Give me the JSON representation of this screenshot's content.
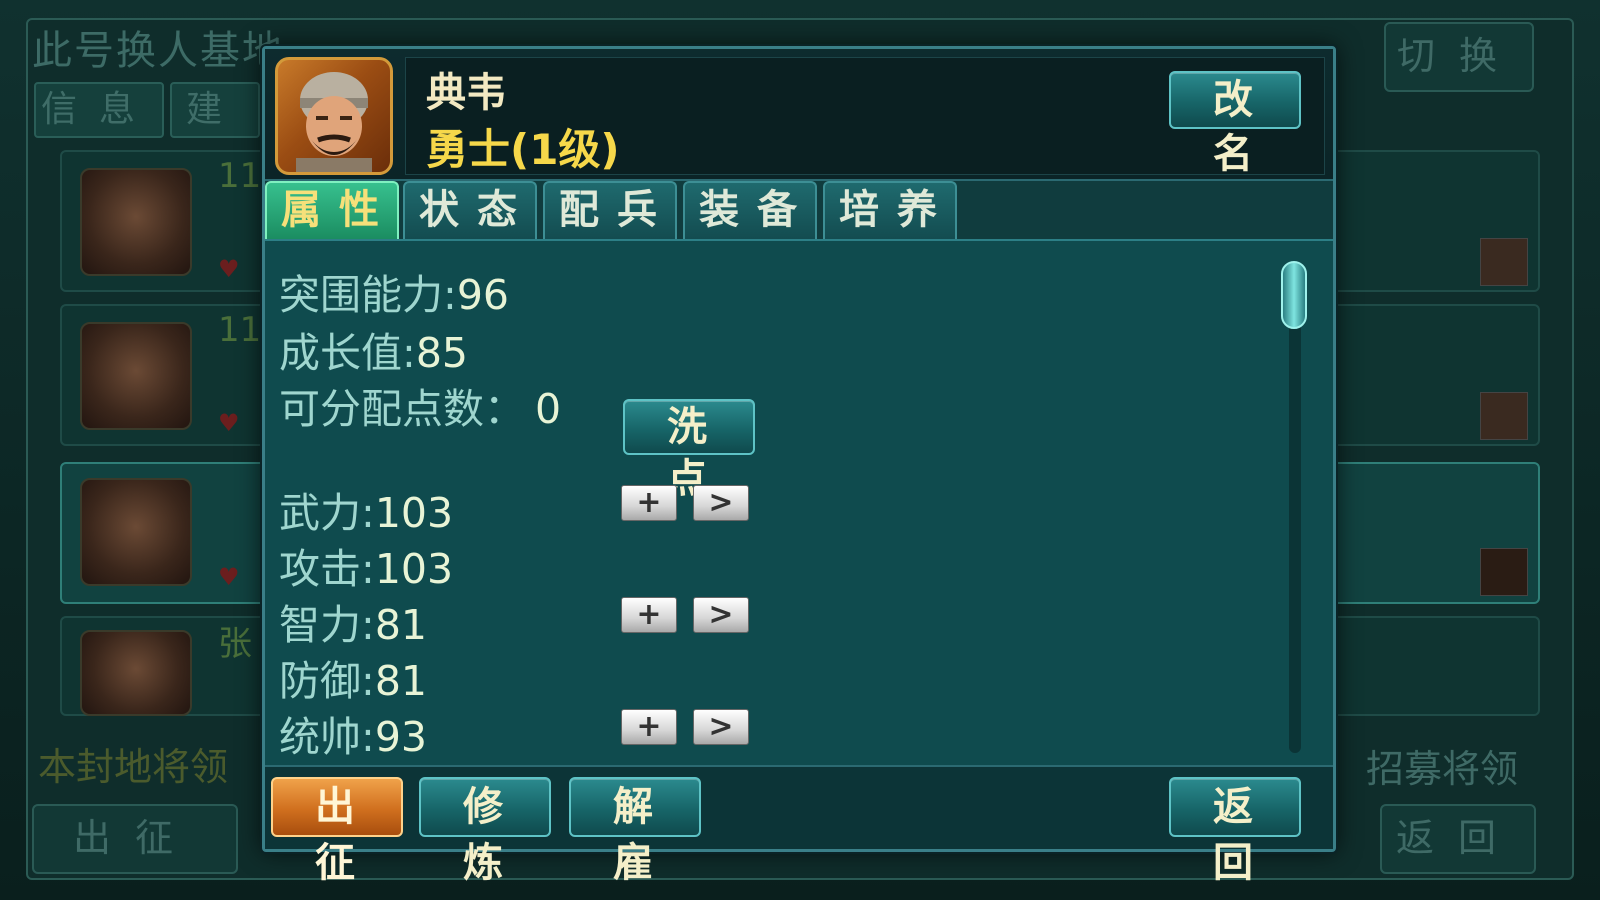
{
  "background": {
    "title": "此号换人基地",
    "tabs": [
      "信息",
      "建"
    ],
    "switch_button": "切换",
    "recruit_label": "招募将领",
    "fief_label": "本封地将领",
    "levels": [
      "11",
      "11"
    ],
    "bottom_left_button": "出征",
    "bottom_right_button": "返回",
    "list_name_fragment": "张"
  },
  "hero": {
    "name": "典韦",
    "rank": "勇士(1级)"
  },
  "rename_button": "改名",
  "tabs": [
    {
      "label": "属性",
      "active": true
    },
    {
      "label": "状态",
      "active": false
    },
    {
      "label": "配兵",
      "active": false
    },
    {
      "label": "装备",
      "active": false
    },
    {
      "label": "培养",
      "active": false
    }
  ],
  "stats": {
    "breakout": {
      "label": "突围能力:",
      "value": "96"
    },
    "growth": {
      "label": "成长值:",
      "value": "85"
    },
    "points": {
      "label": "可分配点数：",
      "value": "0"
    },
    "force": {
      "label": "武力:",
      "value": "103"
    },
    "attack": {
      "label": "攻击:",
      "value": "103"
    },
    "intellect": {
      "label": "智力:",
      "value": "81"
    },
    "defense": {
      "label": "防御:",
      "value": "81"
    },
    "command": {
      "label": "统帅:",
      "value": "93"
    }
  },
  "reset_button": "洗点",
  "stepper": {
    "plus": "+",
    "next": ">"
  },
  "footer": {
    "dispatch": "出征",
    "train": "修炼",
    "dismiss": "解雇",
    "back": "返回"
  },
  "colors": {
    "panel": "#0f4b4e",
    "accent_orange": "#d06f1e",
    "rank_yellow": "#f6d84a"
  }
}
